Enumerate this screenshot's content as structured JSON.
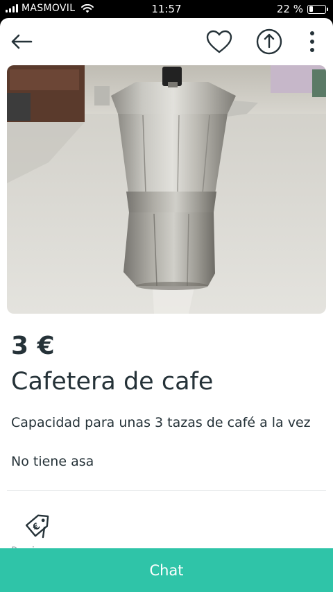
{
  "status_bar": {
    "carrier": "MASMOVIL",
    "time": "11:57",
    "battery": "22 %",
    "battery_level": 0.22
  },
  "topbar": {
    "back_icon": "arrow-left-icon",
    "favorite_icon": "heart-icon",
    "share_icon": "share-icon",
    "more_icon": "more-vertical-icon"
  },
  "listing": {
    "photo": "moka-pot-photo",
    "price": "3 €",
    "title": "Cafetera de cafe",
    "description_lines": [
      "Capacidad para unas 3 tazas de café a la vez",
      "No tiene asa"
    ],
    "tag_icon": "price-tag-icon",
    "tag_label": "Precio no..."
  },
  "actions": {
    "chat_label": "Chat"
  },
  "colors": {
    "accent": "#2fc4a8",
    "text": "#253238"
  }
}
